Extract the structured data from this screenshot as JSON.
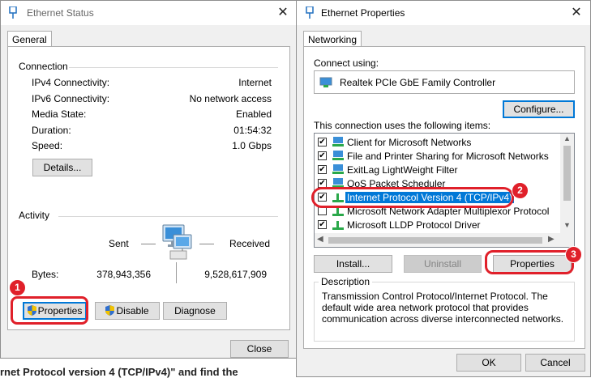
{
  "status_window": {
    "title": "Ethernet Status",
    "tab": "General",
    "connection": {
      "heading": "Connection",
      "rows": [
        {
          "label": "IPv4 Connectivity:",
          "value": "Internet"
        },
        {
          "label": "IPv6 Connectivity:",
          "value": "No network access"
        },
        {
          "label": "Media State:",
          "value": "Enabled"
        },
        {
          "label": "Duration:",
          "value": "01:54:32"
        },
        {
          "label": "Speed:",
          "value": "1.0 Gbps"
        }
      ],
      "details_button": "Details..."
    },
    "activity": {
      "heading": "Activity",
      "sent_label": "Sent",
      "received_label": "Received",
      "bytes_label": "Bytes:",
      "bytes_sent": "378,943,356",
      "bytes_received": "9,528,617,909"
    },
    "buttons": {
      "properties": "Properties",
      "disable": "Disable",
      "diagnose": "Diagnose",
      "close": "Close"
    }
  },
  "properties_window": {
    "title": "Ethernet Properties",
    "tab": "Networking",
    "connect_using_label": "Connect using:",
    "adapter_name": "Realtek PCIe GbE Family Controller",
    "configure_button": "Configure...",
    "items_label": "This connection uses the following items:",
    "items": [
      {
        "label": "Client for Microsoft Networks",
        "checked": true
      },
      {
        "label": "File and Printer Sharing for Microsoft Networks",
        "checked": true
      },
      {
        "label": "ExitLag LightWeight Filter",
        "checked": true
      },
      {
        "label": "QoS Packet Scheduler",
        "checked": true
      },
      {
        "label": "Internet Protocol Version 4 (TCP/IPv4)",
        "checked": true,
        "selected": true
      },
      {
        "label": "Microsoft Network Adapter Multiplexor Protocol",
        "checked": false
      },
      {
        "label": "Microsoft LLDP Protocol Driver",
        "checked": true
      }
    ],
    "buttons": {
      "install": "Install...",
      "uninstall": "Uninstall",
      "properties": "Properties",
      "ok": "OK",
      "cancel": "Cancel"
    },
    "description": {
      "heading": "Description",
      "text": "Transmission Control Protocol/Internet Protocol. The default wide area network protocol that provides communication across diverse interconnected networks."
    }
  },
  "annotations": {
    "step1": "1",
    "step2": "2",
    "step3": "3"
  },
  "page_text": {
    "bottom_left": "rnet Protocol version 4 (TCP/IPv4)\" and find the"
  },
  "colors": {
    "annotation_red": "#e0202a",
    "selection_blue": "#0078d7"
  }
}
